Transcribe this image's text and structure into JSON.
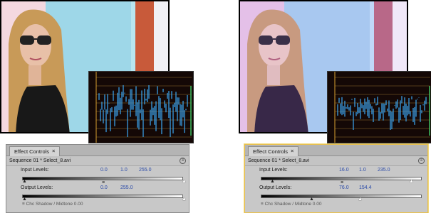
{
  "left": {
    "tab_label": "Effect Controls",
    "tab_close": "×",
    "sequence": "Sequence 01 * Select_8.avi",
    "input_label": "Input Levels:",
    "input_values": [
      "0.0",
      "1.0",
      "255.0"
    ],
    "output_label": "Output Levels:",
    "output_values": [
      "0.0",
      "255.0"
    ],
    "mid_marker": "≡",
    "footer": "≡ Chc Shadow / Midtone   0.00"
  },
  "right": {
    "tab_label": "Effect Controls",
    "tab_close": "×",
    "sequence": "Sequence 01 * Select_8.avi",
    "input_label": "Input Levels:",
    "input_values": [
      "16.0",
      "1.0",
      "235.0"
    ],
    "output_label": "Output Levels:",
    "output_values": [
      "76.0",
      "154.4"
    ],
    "mid_marker": "≡",
    "footer": "≡ Chc Shadow / Midtone   0.00"
  },
  "panel_menu_icon": "≡",
  "colors": {
    "accent_blue": "#2a4aa8",
    "waveform_bg": "#140806",
    "highlight": "#e8c050"
  }
}
